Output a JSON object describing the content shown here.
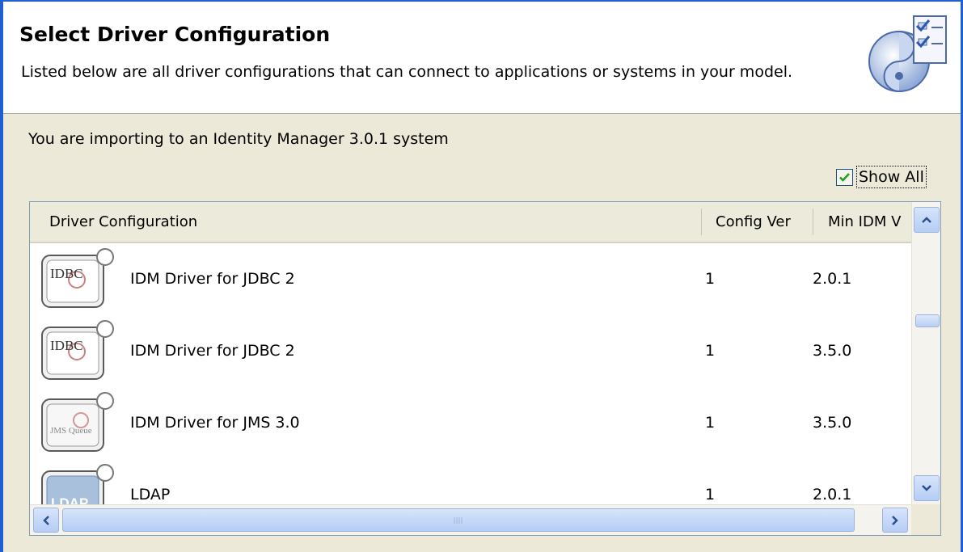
{
  "header": {
    "title": "Select Driver Configuration",
    "description": "Listed below are all driver configurations that can connect to applications or systems in your model."
  },
  "system_message": "You are importing to an Identity Manager 3.0.1 system",
  "show_all": {
    "label": "Show All",
    "checked": true
  },
  "table": {
    "columns": [
      "Driver Configuration",
      "Config Ver",
      "Min IDM V"
    ],
    "rows": [
      {
        "icon": "jdbc-driver-icon",
        "icon_text": "IDBC",
        "name": "IDM Driver for JDBC 2",
        "config_ver": "1",
        "min_idm": "2.0.1"
      },
      {
        "icon": "jdbc-driver-icon",
        "icon_text": "IDBC",
        "name": "IDM Driver for JDBC 2",
        "config_ver": "1",
        "min_idm": "3.5.0"
      },
      {
        "icon": "jms-driver-icon",
        "icon_text": "JMS Queue",
        "name": "IDM Driver for JMS 3.0",
        "config_ver": "1",
        "min_idm": "3.5.0"
      },
      {
        "icon": "ldap-driver-icon",
        "icon_text": "LDAP",
        "name": "LDAP",
        "config_ver": "1",
        "min_idm": "2.0.1"
      }
    ]
  },
  "colors": {
    "window_border": "#1f5fd1",
    "dialog_bg": "#ece9d8",
    "scroll_blue": "#b5cdf5",
    "check_green": "#21a121"
  }
}
